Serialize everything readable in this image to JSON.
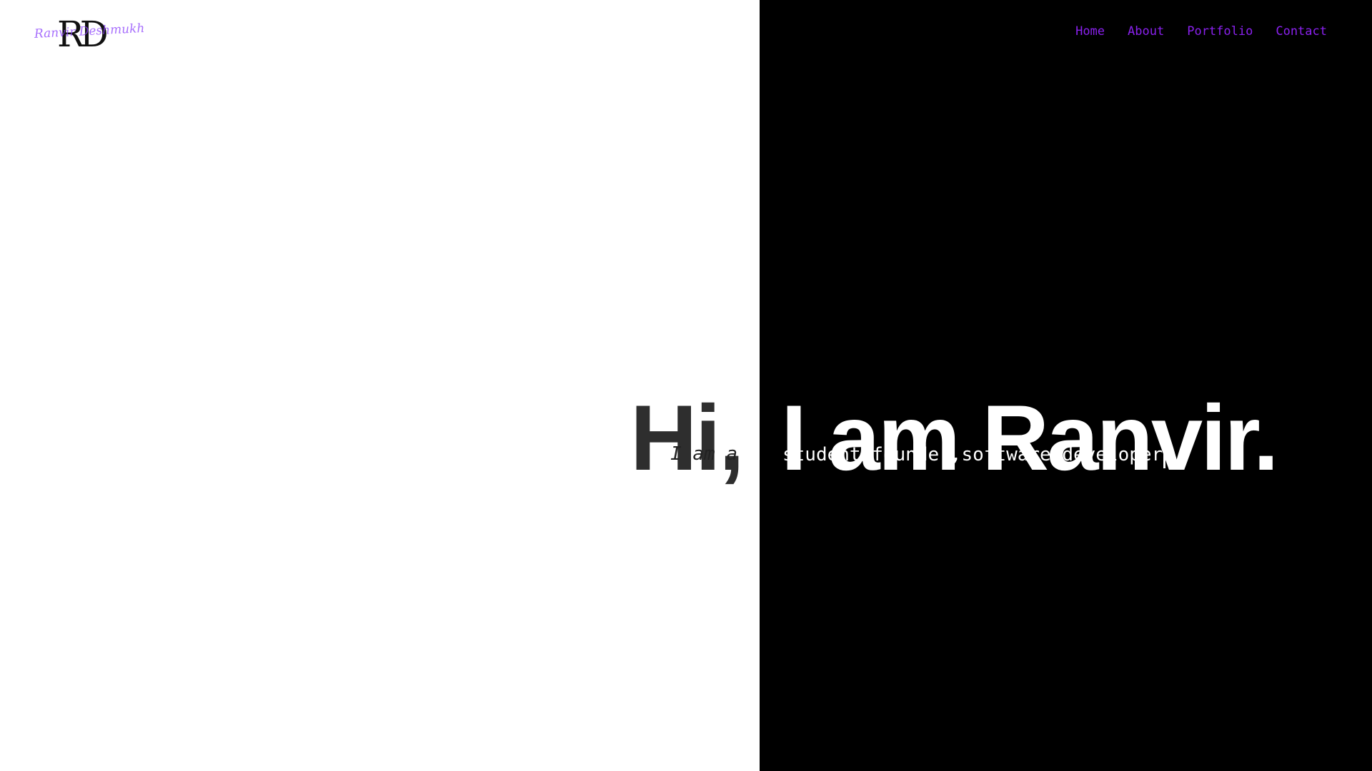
{
  "brand": {
    "initials": "RD",
    "signature": "Ranvir Deshmukh"
  },
  "nav": {
    "items": [
      {
        "label": "Home"
      },
      {
        "label": "About"
      },
      {
        "label": "Portfolio"
      },
      {
        "label": "Contact"
      }
    ],
    "link_color": "#8a21ee"
  },
  "hero": {
    "greeting": "Hi,",
    "headline": "I am Ranvir.",
    "prefix": "I am a",
    "roles_text": "student,founder,software developer"
  },
  "colors": {
    "left_background": "#ffffff",
    "right_background": "#000000",
    "accent": "#8a21ee"
  }
}
